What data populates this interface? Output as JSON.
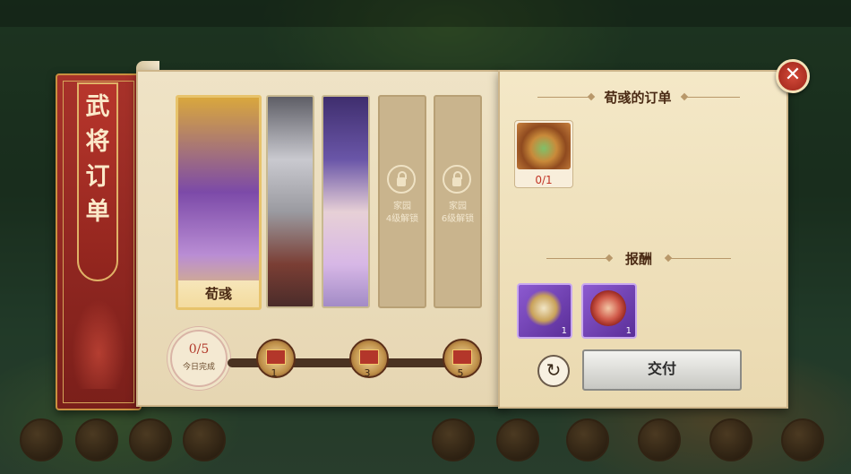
{
  "ribbon": {
    "title": "武将订单"
  },
  "heroes": [
    {
      "name": "荀彧",
      "selected": true
    },
    {
      "name": "",
      "selected": false
    },
    {
      "name": "",
      "selected": false
    }
  ],
  "locked_slots": [
    {
      "line1": "家园",
      "line2": "4级解锁"
    },
    {
      "line1": "家园",
      "line2": "6级解锁"
    }
  ],
  "progress": {
    "count": "0/5",
    "label": "今日完成",
    "milestones": [
      "1",
      "3",
      "5"
    ]
  },
  "order": {
    "title": "荀彧的订单",
    "item_count": "0/1",
    "item_icon": "noodle-bowl-icon"
  },
  "reward": {
    "title": "报酬",
    "items": [
      {
        "icon": "kite-icon",
        "count": "1"
      },
      {
        "icon": "tin-box-icon",
        "count": "1"
      }
    ]
  },
  "actions": {
    "submit_label": "交付",
    "refresh_icon": "↻",
    "close_icon": "✕"
  },
  "colors": {
    "accent_red": "#a8322a",
    "gold": "#e7c36b",
    "reward_purple": "#8c5ad0"
  }
}
